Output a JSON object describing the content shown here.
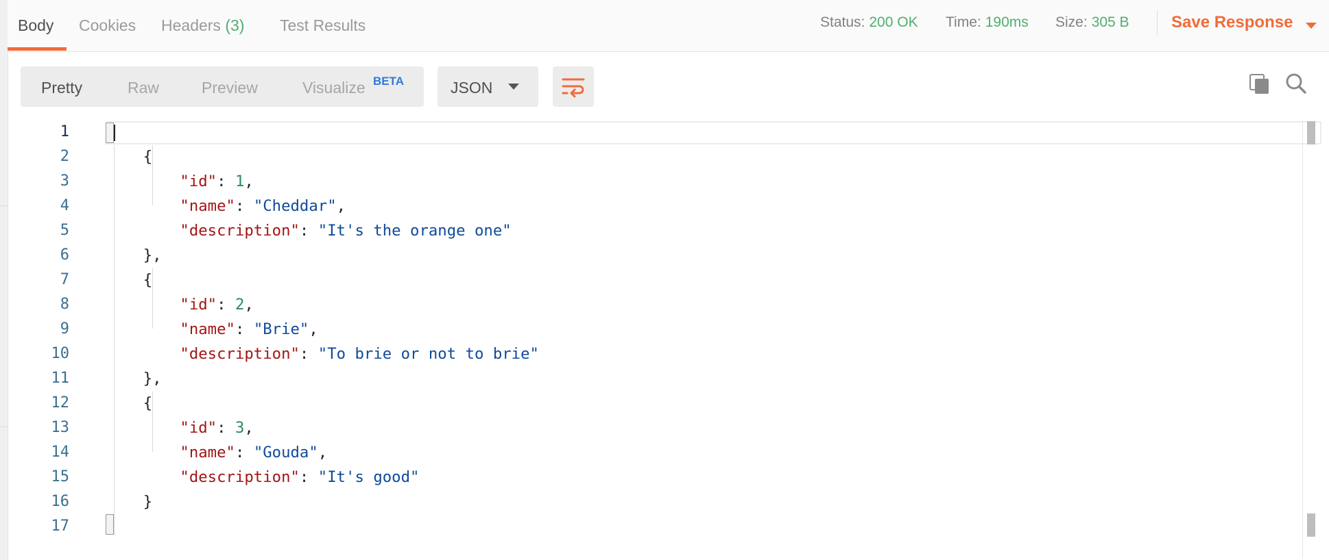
{
  "tabs": {
    "body": "Body",
    "cookies": "Cookies",
    "headers": "Headers",
    "headers_count": "(3)",
    "test_results": "Test Results"
  },
  "status": {
    "label": "Status:",
    "value": "200 OK"
  },
  "time": {
    "label": "Time:",
    "value": "190ms"
  },
  "size": {
    "label": "Size:",
    "value": "305 B"
  },
  "save_response": "Save Response",
  "view_modes": {
    "pretty": "Pretty",
    "raw": "Raw",
    "preview": "Preview",
    "visualize": "Visualize",
    "visualize_badge": "BETA"
  },
  "format": {
    "selected": "JSON"
  },
  "icons": {
    "wrap": "wrap-lines-icon",
    "copy": "copy-icon",
    "search": "search-icon"
  },
  "colors": {
    "accent": "#f26b3a",
    "status_ok": "#4fae6e",
    "beta": "#2f7bd8",
    "json_key": "#a31515",
    "json_string": "#0f4a9a",
    "json_number": "#2d8a5e"
  },
  "editor": {
    "active_line": 1,
    "lines": [
      {
        "n": "1",
        "parts": [
          [
            "p",
            "["
          ]
        ]
      },
      {
        "n": "2",
        "parts": [
          [
            "p",
            "    {"
          ]
        ]
      },
      {
        "n": "3",
        "parts": [
          [
            "p",
            "        "
          ],
          [
            "k",
            "\"id\""
          ],
          [
            "p",
            ": "
          ],
          [
            "n",
            "1"
          ],
          [
            "p",
            ","
          ]
        ]
      },
      {
        "n": "4",
        "parts": [
          [
            "p",
            "        "
          ],
          [
            "k",
            "\"name\""
          ],
          [
            "p",
            ": "
          ],
          [
            "s",
            "\"Cheddar\""
          ],
          [
            "p",
            ","
          ]
        ]
      },
      {
        "n": "5",
        "parts": [
          [
            "p",
            "        "
          ],
          [
            "k",
            "\"description\""
          ],
          [
            "p",
            ": "
          ],
          [
            "s",
            "\"It's the orange one\""
          ]
        ]
      },
      {
        "n": "6",
        "parts": [
          [
            "p",
            "    },"
          ]
        ]
      },
      {
        "n": "7",
        "parts": [
          [
            "p",
            "    {"
          ]
        ]
      },
      {
        "n": "8",
        "parts": [
          [
            "p",
            "        "
          ],
          [
            "k",
            "\"id\""
          ],
          [
            "p",
            ": "
          ],
          [
            "n",
            "2"
          ],
          [
            "p",
            ","
          ]
        ]
      },
      {
        "n": "9",
        "parts": [
          [
            "p",
            "        "
          ],
          [
            "k",
            "\"name\""
          ],
          [
            "p",
            ": "
          ],
          [
            "s",
            "\"Brie\""
          ],
          [
            "p",
            ","
          ]
        ]
      },
      {
        "n": "10",
        "parts": [
          [
            "p",
            "        "
          ],
          [
            "k",
            "\"description\""
          ],
          [
            "p",
            ": "
          ],
          [
            "s",
            "\"To brie or not to brie\""
          ]
        ]
      },
      {
        "n": "11",
        "parts": [
          [
            "p",
            "    },"
          ]
        ]
      },
      {
        "n": "12",
        "parts": [
          [
            "p",
            "    {"
          ]
        ]
      },
      {
        "n": "13",
        "parts": [
          [
            "p",
            "        "
          ],
          [
            "k",
            "\"id\""
          ],
          [
            "p",
            ": "
          ],
          [
            "n",
            "3"
          ],
          [
            "p",
            ","
          ]
        ]
      },
      {
        "n": "14",
        "parts": [
          [
            "p",
            "        "
          ],
          [
            "k",
            "\"name\""
          ],
          [
            "p",
            ": "
          ],
          [
            "s",
            "\"Gouda\""
          ],
          [
            "p",
            ","
          ]
        ]
      },
      {
        "n": "15",
        "parts": [
          [
            "p",
            "        "
          ],
          [
            "k",
            "\"description\""
          ],
          [
            "p",
            ": "
          ],
          [
            "s",
            "\"It's good\""
          ]
        ]
      },
      {
        "n": "16",
        "parts": [
          [
            "p",
            "    }"
          ]
        ]
      },
      {
        "n": "17",
        "parts": [
          [
            "p",
            "]"
          ]
        ]
      }
    ]
  }
}
